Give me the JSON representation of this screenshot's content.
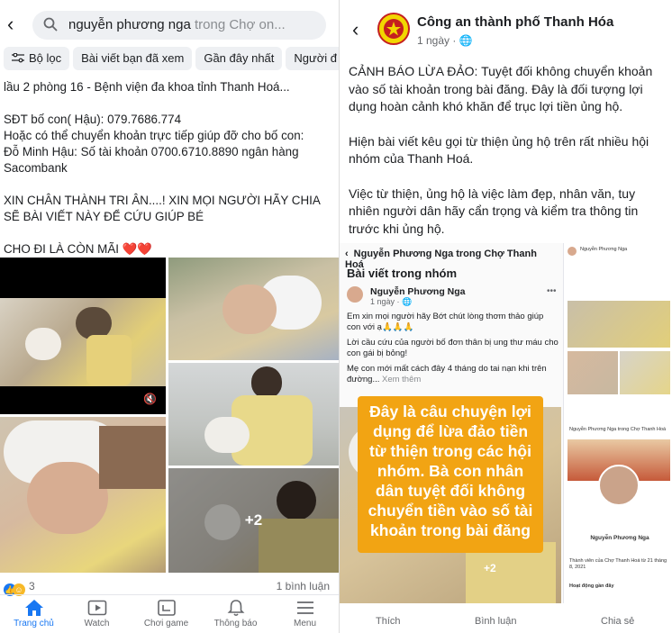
{
  "left": {
    "search": {
      "query": "nguyễn phương nga",
      "scope": " trong Chợ on..."
    },
    "filters": [
      {
        "label": "Bộ lọc",
        "icon": "filter-icon"
      },
      {
        "label": "Bài viết bạn đã xem"
      },
      {
        "label": "Gần đây nhất"
      },
      {
        "label": "Người đ"
      }
    ],
    "post_lines": [
      "lầu 2 phòng 16 - Bệnh viện đa khoa tỉnh Thanh Hoá...",
      "",
      "SĐT bố con( Hậu): 079.7686.774",
      "Hoặc có thể chuyển khoản trực tiếp giúp đỡ cho bố con:",
      "Đỗ Minh Hậu: Số tài khoản 0700.6710.8890 ngân hàng",
      "Sacombank",
      "",
      "XIN CHÂN THÀNH TRI ÂN....! XIN MỌI NGƯỜI HÃY CHIA",
      "SẼ BÀI VIẾT NÀY ĐỂ CỨU GIÚP BÉ",
      "",
      "CHO ĐI LÀ CÒN MÃI ❤️❤️"
    ],
    "more_photos": "+2",
    "reaction_count": "3",
    "comment_count": "1 bình luận",
    "tabs": [
      {
        "label": "Trang chủ",
        "icon": "home-icon",
        "active": true
      },
      {
        "label": "Watch",
        "icon": "watch-icon",
        "active": false
      },
      {
        "label": "Chơi game",
        "icon": "game-icon",
        "active": false
      },
      {
        "label": "Thông báo",
        "icon": "bell-icon",
        "active": false
      },
      {
        "label": "Menu",
        "icon": "menu-icon",
        "active": false
      }
    ]
  },
  "right": {
    "page_name": "Công an thành phố Thanh Hóa",
    "post_time": "1 ngày · 🌐",
    "paragraphs": [
      "CẢNH BÁO LỪA ĐẢO: Tuyệt đối không chuyển khoản vào số tài khoản trong bài đăng. Đây là đối tượng lợi dụng hoàn cảnh khó khăn để trục lợi tiền ủng hộ.",
      "Hiện bài viết kêu gọi từ thiện ủng hộ trên rất nhiều hội nhóm của Thanh Hoá.",
      "Việc từ thiện, ủng hộ là việc làm đẹp, nhân văn, tuy nhiên người dân hãy cẩn trọng và kiểm tra thông tin trước khi ủng hộ."
    ],
    "screenshot": {
      "header": "Nguyễn Phương Nga trong Chợ Thanh Hoá",
      "section": "Bài viết trong nhóm",
      "author": "Nguyễn Phương Nga",
      "time": "1 ngày · 🌐",
      "lines": [
        "Em xin mọi người hãy Bớt chút lòng thơm thảo giúp con với ạ🙏🙏🙏",
        "Lời cầu cứu của người bố đơn thân bị ung thư máu cho con gái bị bỏng!",
        "Mẹ con mới mất cách đây 4 tháng do tai nạn khi trên đường...",
        "Xem thêm"
      ],
      "banner": "Đây là câu chuyện lợi dụng để lừa đảo tiền từ thiện trong các hội nhóm. Bà con nhân dân tuyệt đối không chuyển tiền vào số tài khoản trong bài đăng",
      "side_profile_name": "Nguyễn Phương Nga",
      "side_header": "Nguyễn Phương Nga trong Chợ Thanh Hoá",
      "side_joined": "Thành viên của Chợ Thanh Hoá từ 21 tháng 8, 2021",
      "side_activity": "Hoạt động gần đây",
      "side_plus": "+2"
    },
    "actions": [
      "Thích",
      "Bình luận",
      "Chia sẻ"
    ]
  },
  "colors": {
    "accent": "#1877f2",
    "banner": "#f2a413",
    "heart": "#e0245e"
  }
}
